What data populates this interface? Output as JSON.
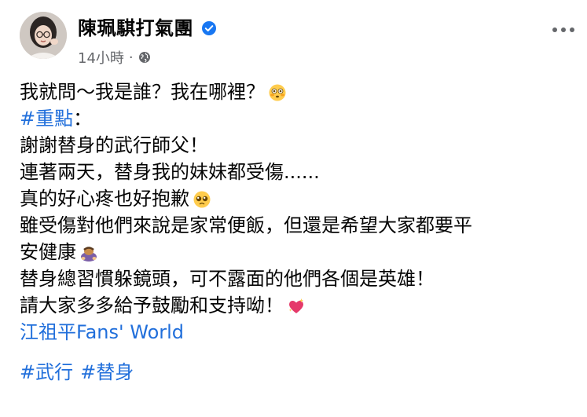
{
  "author": {
    "name": "陳珮騏打氣團",
    "verified_icon": "verified-check-icon",
    "verified_color": "#1877f2",
    "avatar_icon": "profile-avatar"
  },
  "meta": {
    "time": "14小時",
    "separator": "·",
    "privacy_icon": "globe-icon"
  },
  "more_icon": "more-options-icon",
  "post": {
    "line1": "我就問～我是誰？我在哪裡？",
    "hashtag_main": "#重點",
    "hashtag_suffix": "：",
    "line3": "謝謝替身的武行師父！",
    "line4": "連著兩天，替身我的妹妹都受傷......",
    "line5": "真的好心疼也好抱歉",
    "line6": "雖受傷對他們來說是家常便飯，但還是希望大家都要平",
    "line7": "安健康",
    "line8": "替身總習慣躲鏡頭，可不露面的他們各個是英雄！",
    "line9": "請大家多多給予鼓勵和支持呦！",
    "mention": "江祖平Fans' World",
    "tags": [
      "#武行",
      "#替身"
    ]
  },
  "emojis": {
    "flushed": "flushed-face-emoji",
    "pleading": "pleading-face-emoji",
    "bowing": "bowing-person-emoji",
    "heart": "sparkling-heart-emoji"
  },
  "colors": {
    "link": "#216fdb",
    "text": "#050505",
    "secondary": "#65676b"
  }
}
